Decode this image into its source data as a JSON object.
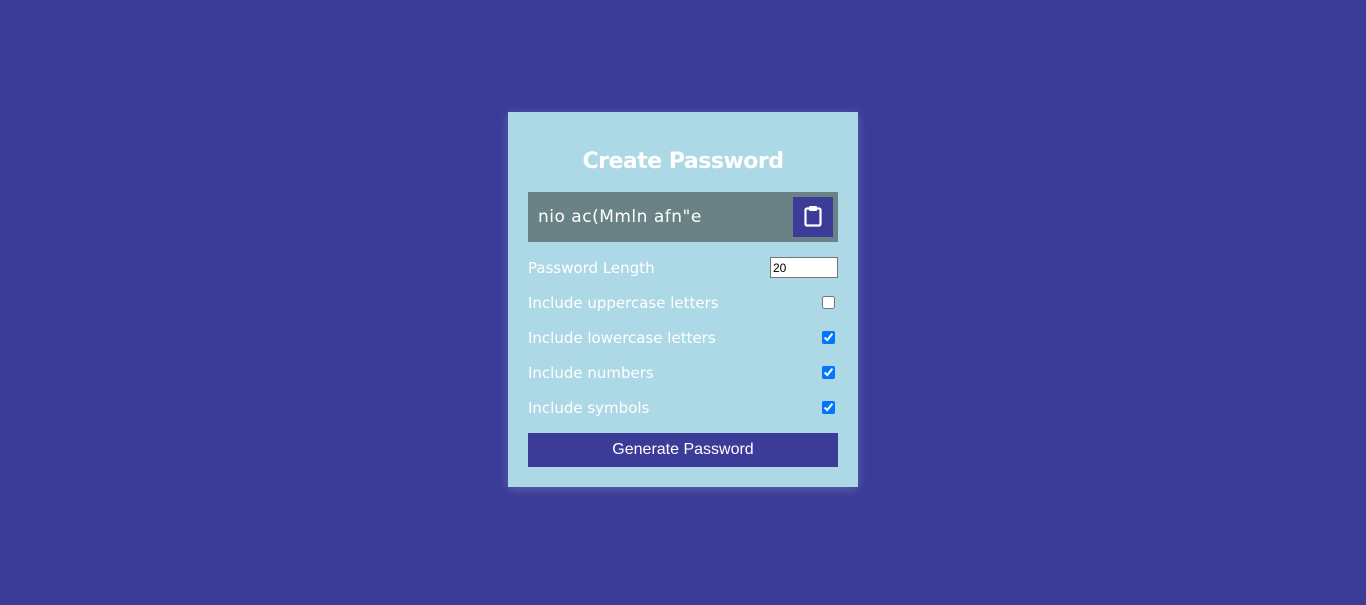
{
  "card": {
    "title": "Create Password",
    "result": "nio ac(Mmln afn\"e",
    "clipboard_icon": "clipboard-icon",
    "settings": {
      "length_label": "Password Length",
      "length_value": "20",
      "uppercase_label": "Include uppercase letters",
      "uppercase_checked": false,
      "lowercase_label": "Include lowercase letters",
      "lowercase_checked": true,
      "numbers_label": "Include numbers",
      "numbers_checked": true,
      "symbols_label": "Include symbols",
      "symbols_checked": true
    },
    "generate_label": "Generate Password"
  },
  "colors": {
    "background": "#3b3b98",
    "card": "#add8e6",
    "result_box": "#6a8285",
    "accent": "#3b3b98"
  }
}
